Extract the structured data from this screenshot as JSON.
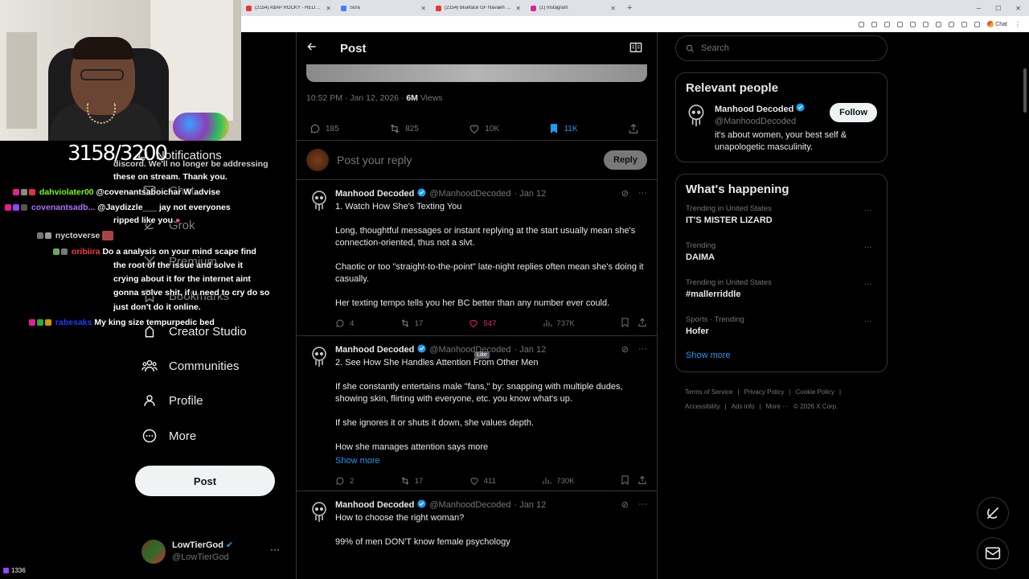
{
  "browser": {
    "tabs": [
      {
        "title": "(2154) A$AP ROCKY - HELICOPTE...",
        "icon": "youtube-icon"
      },
      {
        "title": "Sora",
        "icon": "sora-icon"
      },
      {
        "title": "(2154) Blueface GF Navaeh called...",
        "icon": "youtube-icon"
      },
      {
        "title": "(1) Instagram",
        "icon": "instagram-icon"
      }
    ],
    "chat_label": "Chat"
  },
  "stream": {
    "sub_count": "3158/3200",
    "viewer_count": "1336",
    "chat": [
      {
        "user": "",
        "text": "discord. We'll no longer be addressing"
      },
      {
        "user": "",
        "text": "these on stream. Thank you."
      },
      {
        "user": "dahviolater00",
        "text": "@covenantsaboichar W advise"
      },
      {
        "user": "covenantsadb...",
        "text": "@Jaydizzle___ jay not everyones"
      },
      {
        "user": "",
        "text": "ripped like you"
      },
      {
        "user": "nyctoverse",
        "text": ""
      },
      {
        "user": "oribiira",
        "text": "Do a analysis on your mind scape find"
      },
      {
        "user": "",
        "text": "the root of the issue and solve it"
      },
      {
        "user": "",
        "text": "crying about it for the internet aint"
      },
      {
        "user": "",
        "text": "gonna solve shit, if u need to cry do so"
      },
      {
        "user": "",
        "text": "just don't do it online."
      },
      {
        "user": "rabesaks",
        "text": "My king size tempurpedic bed"
      }
    ]
  },
  "nav": {
    "items": [
      {
        "label": "Notifications",
        "icon": "bell-icon"
      },
      {
        "label": "Chat",
        "icon": "mail-icon"
      },
      {
        "label": "Grok",
        "icon": "grok-icon"
      },
      {
        "label": "Premium",
        "icon": "x-logo-icon"
      },
      {
        "label": "Bookmarks",
        "icon": "bookmark-icon"
      },
      {
        "label": "Creator Studio",
        "icon": "creator-icon"
      },
      {
        "label": "Communities",
        "icon": "people-icon"
      },
      {
        "label": "Profile",
        "icon": "person-icon"
      },
      {
        "label": "More",
        "icon": "more-circle-icon"
      }
    ],
    "post_label": "Post",
    "account": {
      "name": "LowTierGod",
      "handle": "@LowTierGod"
    }
  },
  "post": {
    "header_title": "Post",
    "timestamp": "10:52 PM · Jan 12, 2026 ·",
    "views_value": "6M",
    "views_label": "Views",
    "replies": "185",
    "reposts": "825",
    "likes": "10K",
    "bookmarks": "11K",
    "reply_placeholder": "Post your reply",
    "reply_button": "Reply"
  },
  "replies": [
    {
      "name": "Manhood Decoded",
      "handle": "@ManhoodDecoded",
      "date": "· Jan 12",
      "lines": [
        "1. Watch How She's Texting You",
        "Long, thoughtful messages or instant replying at the start usually mean she's connection-oriented, thus not a slvt.",
        "Chaotic or too \"straight-to-the-point\" late-night replies often mean she's doing it casually.",
        "Her texting tempo tells you her BC better than any number ever could."
      ],
      "replies": "4",
      "reposts": "17",
      "likes": "547",
      "views": "737K",
      "liked": true
    },
    {
      "name": "Manhood Decoded",
      "handle": "@ManhoodDecoded",
      "date": "· Jan 12",
      "lines": [
        "2. See How She Handles Attention From Other Men",
        "If she constantly entertains male \"fans,\" by: snapping with multiple dudes, showing skin, flirting with everyone, etc. you know what's up.",
        "If she ignores it or shuts it down, she values depth.",
        "How she manages attention says more"
      ],
      "show_more": "Show more",
      "replies": "2",
      "reposts": "17",
      "likes": "411",
      "views": "730K",
      "liked": false
    },
    {
      "name": "Manhood Decoded",
      "handle": "@ManhoodDecoded",
      "date": "· Jan 12",
      "lines": [
        "How to choose the right woman?",
        "99% of men DON'T know female psychology"
      ]
    }
  ],
  "tooltip": "Like",
  "sidebar": {
    "search_placeholder": "Search",
    "relevant_title": "Relevant people",
    "relevant": {
      "name": "Manhood Decoded",
      "handle": "@ManhoodDecoded",
      "bio": "it's about women, your best self & unapologetic masculinity.",
      "follow": "Follow"
    },
    "happening_title": "What's happening",
    "trends": [
      {
        "label": "Trending in United States",
        "name": "IT'S MISTER LIZARD"
      },
      {
        "label": "Trending",
        "name": "DAIMA"
      },
      {
        "label": "Trending in United States",
        "name": "#mallerriddle"
      },
      {
        "label": "Sports · Trending",
        "name": "Hofer"
      }
    ],
    "show_more": "Show more",
    "footer": [
      "Terms of Service",
      "|",
      "Privacy Policy",
      "|",
      "Cookie Policy",
      "|",
      "Accessibility",
      "|",
      "Ads info",
      "|",
      "More ···",
      "© 2026 X Corp."
    ]
  },
  "colors": {
    "accent": "#1d9bf0",
    "like": "#f91880",
    "bg": "#000000"
  }
}
